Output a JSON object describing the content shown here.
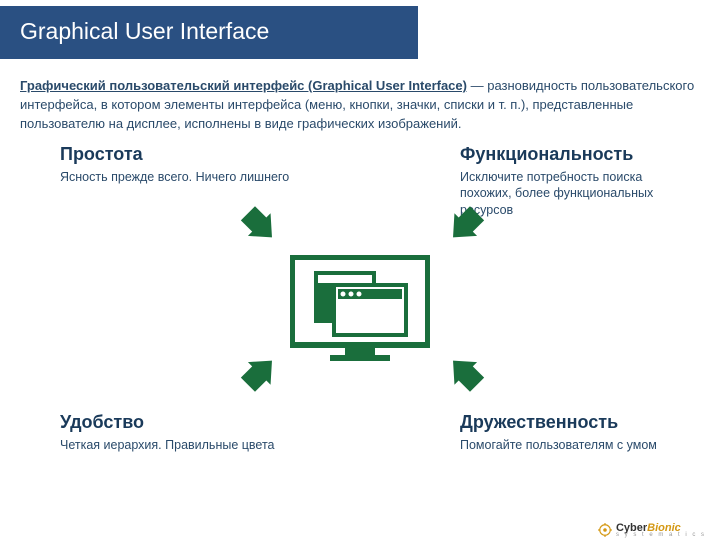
{
  "title": "Graphical User Interface",
  "description_term": "Графический пользовательский интерфейс (Graphical User Interface)",
  "description_rest": " — разновидность пользовательского интерфейса, в котором элементы интерфейса (меню, кнопки, значки, списки и т. п.), представленные пользователю на дисплее, исполнены в виде графических изображений.",
  "quadrants": {
    "topleft": {
      "title": "Простота",
      "text": "Ясность прежде всего. Ничего лишнего"
    },
    "topright": {
      "title": "Функциональность",
      "text": "Исключите потребность поиска похожих, более функциональных ресурсов"
    },
    "botleft": {
      "title": "Удобство",
      "text": "Четкая иерархия. Правильные цвета"
    },
    "botright": {
      "title": "Дружественность",
      "text": "Помогайте пользователям с умом"
    }
  },
  "footer": {
    "brand1": "Cyber",
    "brand2": "Bionic",
    "sub": "s y s t e m a t i c s"
  },
  "colors": {
    "primary": "#2a5082",
    "accent": "#1a6e3c"
  }
}
